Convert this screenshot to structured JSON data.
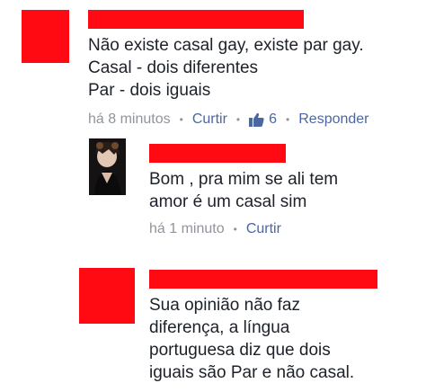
{
  "colors": {
    "redaction": "#ff0a12",
    "link": "#4b67a1",
    "meta": "#90949c",
    "text": "#1d2129"
  },
  "comments": [
    {
      "avatar": "redacted",
      "lines": [
        "Não existe casal gay, existe par gay.",
        "Casal - dois diferentes",
        "Par - dois iguais"
      ],
      "time": "há 8 minutos",
      "like_label": "Curtir",
      "like_icon": "thumbs-up-icon",
      "like_count": "6",
      "reply_label": "Responder"
    },
    {
      "avatar": "photo",
      "lines": [
        "Bom , pra mim se ali tem",
        "amor é um casal sim"
      ],
      "time": "há 1 minuto",
      "like_label": "Curtir"
    },
    {
      "avatar": "redacted",
      "lines": [
        "Sua opinião não faz",
        "diferença, a língua",
        "portuguesa diz que dois",
        "iguais são Par e não casal."
      ]
    }
  ]
}
